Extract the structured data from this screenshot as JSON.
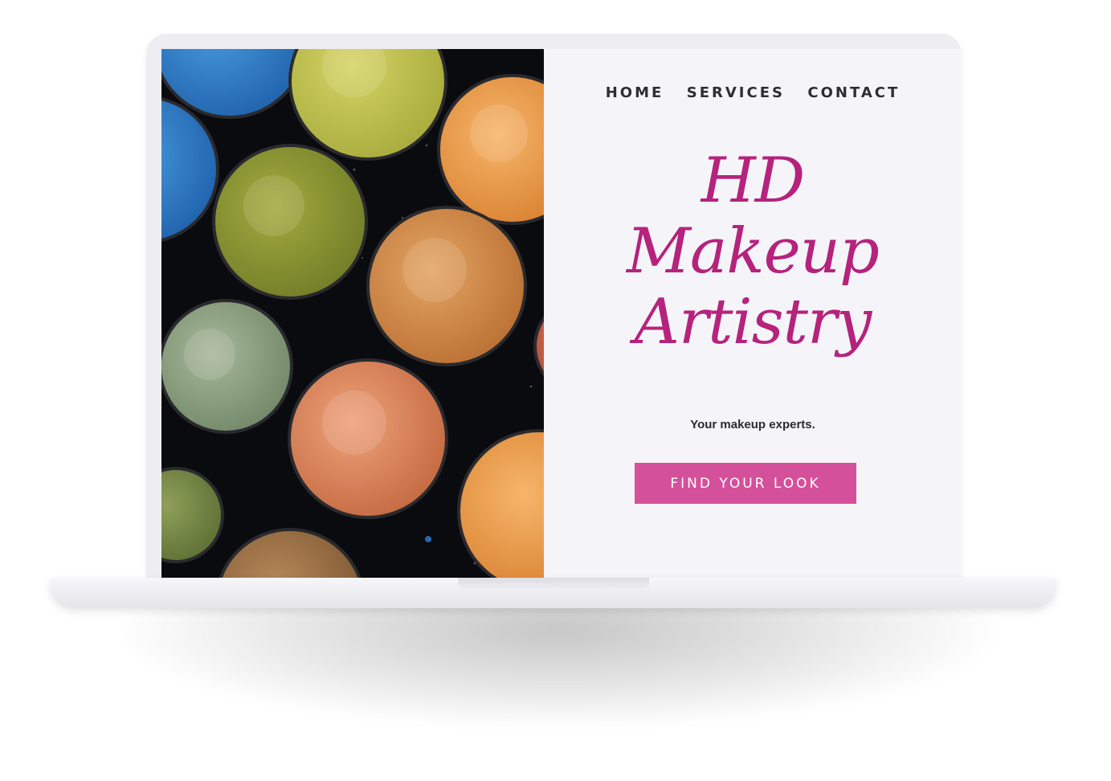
{
  "nav": {
    "home": "HOME",
    "services": "SERVICES",
    "contact": "CONTACT"
  },
  "hero": {
    "title_line1": "HD",
    "title_line2": "Makeup",
    "title_line3": "Artistry",
    "tagline": "Your makeup experts.",
    "cta_label": "FIND YOUR LOOK"
  },
  "colors": {
    "accent": "#b5237d",
    "button": "#d5509a",
    "screen_bg": "#f5f5f9",
    "nav_text": "#2d2d33"
  },
  "image": {
    "subject": "eyeshadow-palette-photo"
  }
}
